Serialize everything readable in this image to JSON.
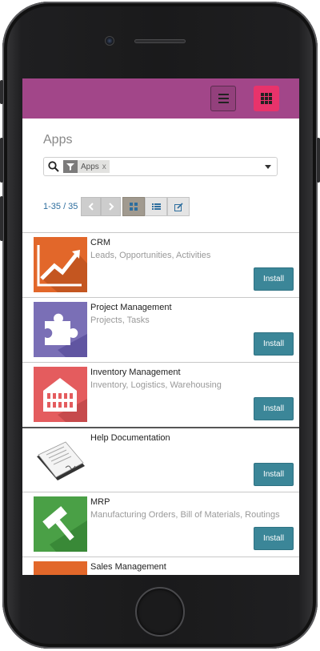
{
  "topbar": {
    "menu_icon": "hamburger-icon",
    "apps_icon": "grid-icon",
    "accent": "#a24689",
    "apps_button_color": "#e8336b"
  },
  "control_panel": {
    "title": "Apps",
    "search": {
      "facet_icon": "filter-icon",
      "facet_value": "Apps",
      "facet_remove": "x",
      "dropdown_icon": "caret-down-icon"
    },
    "pager": {
      "value": "1-35 / 35",
      "prev_icon": "chevron-left-icon",
      "next_icon": "chevron-right-icon"
    },
    "views": [
      {
        "icon": "kanban-icon",
        "active": true
      },
      {
        "icon": "list-icon",
        "active": false
      },
      {
        "icon": "form-edit-icon",
        "active": false
      }
    ]
  },
  "apps": [
    {
      "name": "CRM",
      "summary": "Leads, Opportunities, Activities",
      "button": "Install",
      "icon": "crm-chart-icon",
      "color": "#e2672a"
    },
    {
      "name": "Project Management",
      "summary": "Projects, Tasks",
      "button": "Install",
      "icon": "puzzle-icon",
      "color": "#7a6fb6"
    },
    {
      "name": "Inventory Management",
      "summary": "Inventory, Logistics, Warehousing",
      "button": "Install",
      "icon": "warehouse-icon",
      "color": "#e45c5e"
    },
    {
      "name": "Help Documentation",
      "summary": "",
      "button": "Install",
      "icon": "documents-icon",
      "color": "#ffffff"
    },
    {
      "name": "MRP",
      "summary": "Manufacturing Orders, Bill of Materials, Routings",
      "button": "Install",
      "icon": "hammer-icon",
      "color": "#4aa046"
    },
    {
      "name": "Sales Management",
      "summary": "",
      "button": "",
      "icon": "sales-icon",
      "color": "#e2672a"
    }
  ]
}
